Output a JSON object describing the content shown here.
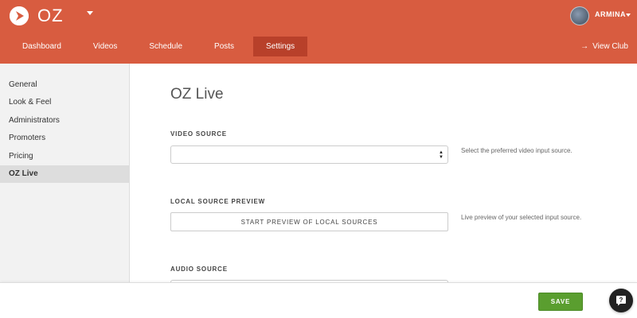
{
  "header": {
    "club_name": "OZ",
    "user_name": "ARMINA",
    "nav_tabs": [
      {
        "label": "Dashboard",
        "active": false
      },
      {
        "label": "Videos",
        "active": false
      },
      {
        "label": "Schedule",
        "active": false
      },
      {
        "label": "Posts",
        "active": false
      },
      {
        "label": "Settings",
        "active": true
      }
    ],
    "view_club_label": "View Club",
    "brand_color": "#d85c40",
    "active_tab_color": "#b8402a"
  },
  "sidebar": {
    "items": [
      {
        "label": "General",
        "active": false
      },
      {
        "label": "Look & Feel",
        "active": false
      },
      {
        "label": "Administrators",
        "active": false
      },
      {
        "label": "Promoters",
        "active": false
      },
      {
        "label": "Pricing",
        "active": false
      },
      {
        "label": "OZ Live",
        "active": true
      }
    ]
  },
  "main": {
    "title": "OZ Live",
    "video_source": {
      "label": "VIDEO SOURCE",
      "value": "",
      "help": "Select the preferred video input source."
    },
    "local_preview": {
      "label": "LOCAL SOURCE PREVIEW",
      "button_label": "START PREVIEW OF LOCAL SOURCES",
      "help": "Live preview of your selected input source."
    },
    "audio_source": {
      "label": "AUDIO SOURCE"
    }
  },
  "footer": {
    "save_label": "SAVE",
    "save_color": "#5a9e2f"
  },
  "icons": {
    "logo": "play-logo-icon",
    "view_club": "arrow-right-icon",
    "help": "help-question-icon"
  }
}
